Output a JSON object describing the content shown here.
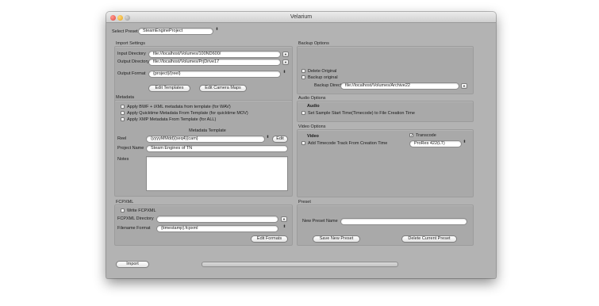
{
  "window": {
    "title": "Velarium"
  },
  "preset": {
    "label": "Select Preset",
    "value": "SteamEngineProject",
    "stepper_icon": "updown-arrows-icon"
  },
  "import_settings": {
    "title": "Import Settings",
    "input_label": "Input Directory",
    "input_value": "file://localhost/Volumes/100ND600/",
    "output_label": "Output Directory",
    "output_value": "file://localhost/Volumes/PrjDrive17",
    "format_label": "Output Format",
    "format_value": "{project}/{reel}",
    "edit_templates": "Edit Templates",
    "edit_camera_maps": "Edit Camera Maps"
  },
  "backup_options": {
    "title": "Backup Options",
    "delete_original": "Delete Original",
    "backup_original": "Backup original",
    "dir_label": "Backup Directory",
    "dir_value": "file://localhost/Volumes/Archive22"
  },
  "metadata": {
    "title": "Metadata",
    "options": [
      "Apply BWF + iXML metadata from template (for WAV)",
      "Apply Quicktime Metadata From Template (for quicktime MOV)",
      "Apply XMP Metadata From Template (for ALL)"
    ],
    "template_title": "Metadata Template",
    "reel_label": "Reel",
    "reel_value": "{yyyyMMdd}{seq4}{cam}",
    "edit": "Edit",
    "project_label": "Project Name",
    "project_value": "Steam Engines of TN",
    "notes_label": "Notes",
    "notes_value": ""
  },
  "audio_options": {
    "title": "Audio Options",
    "heading": "Audio",
    "sample_start": "Set Sample Start Time(Timecode) to File Creation Time"
  },
  "video_options": {
    "title": "Video Options",
    "heading": "Video",
    "add_timecode": "Add Timecode Track From Creation Time",
    "transcode": "Transcode",
    "transcode_checked": true,
    "codec": "ProRes 422(LT)",
    "checkmark": "✓"
  },
  "fcpxml": {
    "title": "FCPXML",
    "write": "Write FCPXML",
    "dir_label": "FCPXML Directory",
    "dir_value": "",
    "filename_label": "Filename Format",
    "filename_value": "{timestamp}.fcpxml",
    "edit_formats": "Edit Formats"
  },
  "preset_panel": {
    "title": "Preset",
    "name_label": "New Preset Name",
    "name_value": "",
    "save": "Save New Preset",
    "delete": "Delete Current Preset"
  },
  "footer": {
    "import": "Import",
    "progress": 0
  },
  "glyphs": {
    "updown": "⬍",
    "down": "▼"
  }
}
